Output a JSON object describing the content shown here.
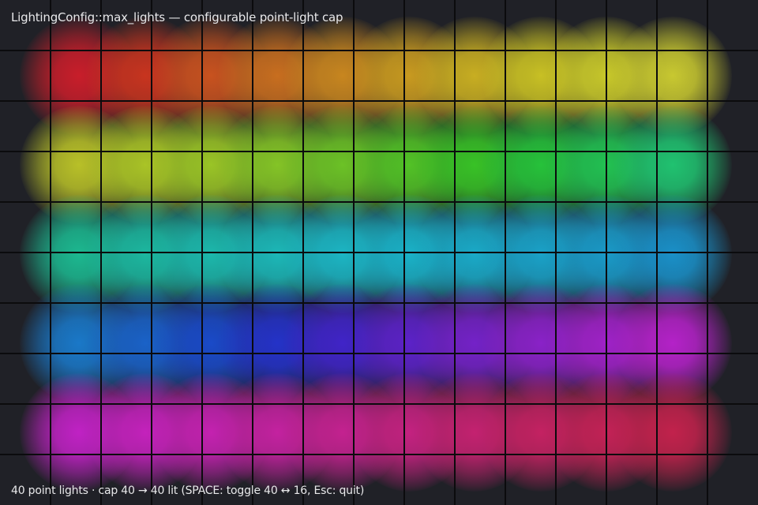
{
  "hud": {
    "title": "LightingConfig::max_lights — configurable point-light cap",
    "status": "40 point lights · cap 40 → 40 lit   (SPACE: toggle 40 ↔ 16,  Esc: quit)"
  },
  "scene": {
    "background_color": "#202127",
    "grid_line_color": "#0b0b0d",
    "grid_columns": 15,
    "grid_rows": 10,
    "point_lights": [
      {
        "row": 0,
        "col": 0,
        "color": "#c81e2a"
      },
      {
        "row": 0,
        "col": 1,
        "color": "#c8341f"
      },
      {
        "row": 0,
        "col": 2,
        "color": "#c8521f"
      },
      {
        "row": 0,
        "col": 3,
        "color": "#c86e1f"
      },
      {
        "row": 0,
        "col": 4,
        "color": "#c8861f"
      },
      {
        "row": 0,
        "col": 5,
        "color": "#c89a20"
      },
      {
        "row": 0,
        "col": 6,
        "color": "#c8ae22"
      },
      {
        "row": 0,
        "col": 7,
        "color": "#c8c024"
      },
      {
        "row": 0,
        "col": 8,
        "color": "#c8c82a"
      },
      {
        "row": 0,
        "col": 9,
        "color": "#c8c830"
      },
      {
        "row": 1,
        "col": 0,
        "color": "#b8c028"
      },
      {
        "row": 1,
        "col": 1,
        "color": "#aac426"
      },
      {
        "row": 1,
        "col": 2,
        "color": "#9ac426"
      },
      {
        "row": 1,
        "col": 3,
        "color": "#84c426"
      },
      {
        "row": 1,
        "col": 4,
        "color": "#6cc226"
      },
      {
        "row": 1,
        "col": 5,
        "color": "#52c226"
      },
      {
        "row": 1,
        "col": 6,
        "color": "#38c226"
      },
      {
        "row": 1,
        "col": 7,
        "color": "#26c23a"
      },
      {
        "row": 1,
        "col": 8,
        "color": "#22c252"
      },
      {
        "row": 1,
        "col": 9,
        "color": "#20c270"
      },
      {
        "row": 2,
        "col": 0,
        "color": "#1cb890"
      },
      {
        "row": 2,
        "col": 1,
        "color": "#1cb8a0"
      },
      {
        "row": 2,
        "col": 2,
        "color": "#1cb8ac"
      },
      {
        "row": 2,
        "col": 3,
        "color": "#1cb8b8"
      },
      {
        "row": 2,
        "col": 4,
        "color": "#1cb6c4"
      },
      {
        "row": 2,
        "col": 5,
        "color": "#1ab2c8"
      },
      {
        "row": 2,
        "col": 6,
        "color": "#1aaac8"
      },
      {
        "row": 2,
        "col": 7,
        "color": "#1aa2c8"
      },
      {
        "row": 2,
        "col": 8,
        "color": "#1a9ac8"
      },
      {
        "row": 2,
        "col": 9,
        "color": "#1a90c8"
      },
      {
        "row": 3,
        "col": 0,
        "color": "#1a78c8"
      },
      {
        "row": 3,
        "col": 1,
        "color": "#1a62c8"
      },
      {
        "row": 3,
        "col": 2,
        "color": "#1a4ac8"
      },
      {
        "row": 3,
        "col": 3,
        "color": "#2432c8"
      },
      {
        "row": 3,
        "col": 4,
        "color": "#4024c8"
      },
      {
        "row": 3,
        "col": 5,
        "color": "#5c22c8"
      },
      {
        "row": 3,
        "col": 6,
        "color": "#7422c8"
      },
      {
        "row": 3,
        "col": 7,
        "color": "#8a22c8"
      },
      {
        "row": 3,
        "col": 8,
        "color": "#a022c8"
      },
      {
        "row": 3,
        "col": 9,
        "color": "#b422c8"
      },
      {
        "row": 4,
        "col": 0,
        "color": "#c022c4"
      },
      {
        "row": 4,
        "col": 1,
        "color": "#c422bc"
      },
      {
        "row": 4,
        "col": 2,
        "color": "#c422b0"
      },
      {
        "row": 4,
        "col": 3,
        "color": "#c422a0"
      },
      {
        "row": 4,
        "col": 4,
        "color": "#c42290"
      },
      {
        "row": 4,
        "col": 5,
        "color": "#c42280"
      },
      {
        "row": 4,
        "col": 6,
        "color": "#c42270"
      },
      {
        "row": 4,
        "col": 7,
        "color": "#c42262"
      },
      {
        "row": 4,
        "col": 8,
        "color": "#c42256"
      },
      {
        "row": 4,
        "col": 9,
        "color": "#c2224c"
      }
    ]
  }
}
